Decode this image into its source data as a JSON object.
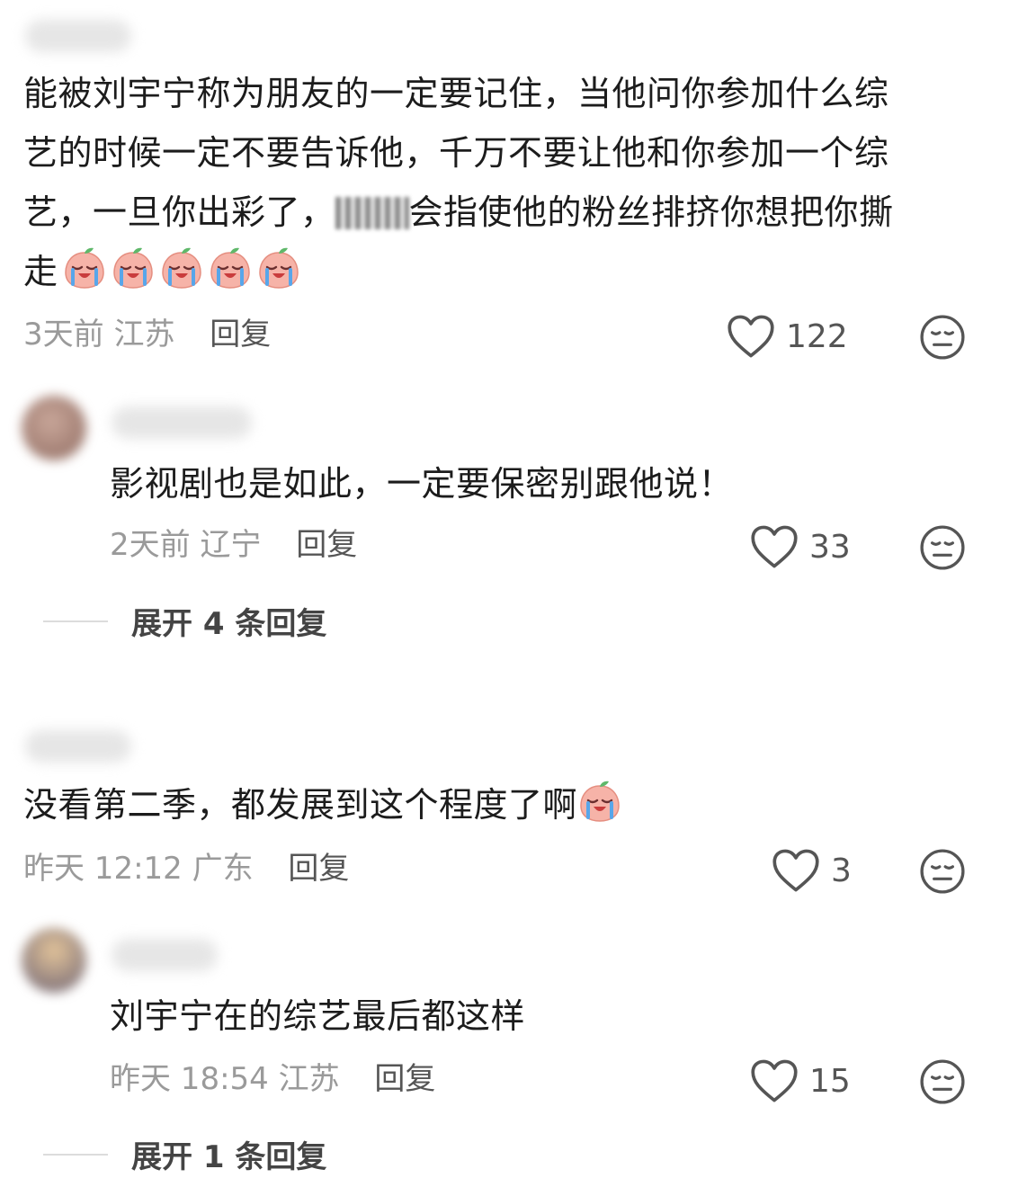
{
  "comments": [
    {
      "text_line1": "能被刘宇宁称为朋友的一定要记住，当他问你参加什么综",
      "text_line2": "艺的时候一定不要告诉他，千万不要让他和你参加一个综",
      "text_line3a": "艺，一旦你出彩了，",
      "text_line3b": "会指使他的粉丝排挤你想把你撕",
      "text_line4": "走",
      "emoji_count": 5,
      "time": "3天前",
      "location": "江苏",
      "reply_label": "回复",
      "likes": "122",
      "reply": {
        "text": "影视剧也是如此，一定要保密别跟他说！",
        "time": "2天前",
        "location": "辽宁",
        "reply_label": "回复",
        "likes": "33"
      },
      "expand_label": "展开 4 条回复"
    },
    {
      "text": "没看第二季，都发展到这个程度了啊",
      "time": "昨天 12:12",
      "location": "广东",
      "reply_label": "回复",
      "likes": "3",
      "reply": {
        "text": "刘宇宁在的综艺最后都这样",
        "time": "昨天 18:54",
        "location": "江苏",
        "reply_label": "回复",
        "likes": "15"
      },
      "expand_label": "展开 1 条回复"
    }
  ],
  "icons": {
    "like": "heart-outline-icon",
    "dislike": "meh-face-icon",
    "emoji": "crying-peach-emoji"
  },
  "colors": {
    "text": "#1c1c1c",
    "meta": "#9a9a9a",
    "icon": "#555555"
  }
}
